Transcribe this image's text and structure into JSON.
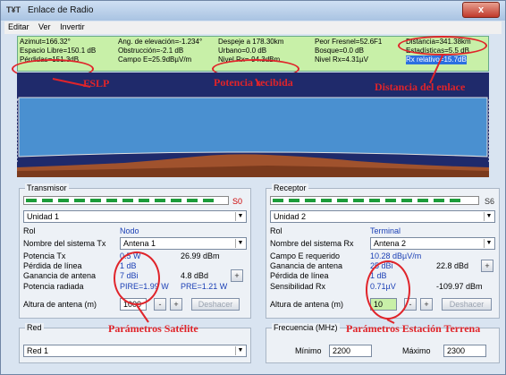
{
  "window": {
    "title": "Enlace de Radio",
    "app_icon": "T¥T",
    "close_label": "x"
  },
  "menu": [
    "Editar",
    "Ver",
    "Invertir"
  ],
  "info": {
    "azimut": "Azimut=166.32°",
    "espacio_libre": "Espacio Libre=150.1 dB",
    "perdidas": "Pérdidas=151.3dB",
    "ang_elev": "Ang. de elevación=-1.234°",
    "obstruccion": "Obstrucción=-2.1 dB",
    "campo_e": "Campo E=25.9dBµV/m",
    "despeje": "Despeje a 178.30km",
    "urbano": "Urbano=0.0 dB",
    "nivel_rx_dbm": "Nivel Rx=-94.3dBm",
    "peor_fresnel": "Peor Fresnel=52.6F1",
    "bosque": "Bosque=0.0 dB",
    "nivel_rx_uv": "Nivel Rx=4.31µV",
    "distancia": "Distancia=341.38km",
    "estadisticas": "Estadísticas=5.5 dB",
    "rx_relativo": "Rx relativo=15.7dB"
  },
  "annotations": {
    "fslp": "FSLP",
    "potencia": "Potencia recibida",
    "distancia": "Distancia del enlace",
    "sat": "Parámetros Satélite",
    "terrena": "Parámetros Estación Terrena"
  },
  "transmisor": {
    "group": "Transmisor",
    "meter_label": "S0",
    "unit": "Unidad  1",
    "rol_label": "Rol",
    "rol_value": "Nodo",
    "sistema_label": "Nombre del sistema Tx",
    "sistema_value": "Antena 1",
    "potencia_label": "Potencia Tx",
    "potencia_w": "0.5 W",
    "potencia_dbm": "26.99 dBm",
    "perdida_label": "Pérdida de línea",
    "perdida_value": "1 dB",
    "ganancia_label": "Ganancia de antena",
    "ganancia_dbi": "7 dBi",
    "ganancia_dbd": "4.8 dBd",
    "radiada_label": "Potencia radiada",
    "pire": "PIRE=1.99 W",
    "pre": "PRE=1.21 W",
    "altura_label": "Altura de antena (m)",
    "altura_value": "1000",
    "deshacer": "Deshacer"
  },
  "receptor": {
    "group": "Receptor",
    "meter_label": "S6",
    "unit": "Unidad  2",
    "rol_label": "Rol",
    "rol_value": "Terminal",
    "sistema_label": "Nombre del sistema Rx",
    "sistema_value": "Antena  2",
    "campo_label": "Campo E requerido",
    "campo_value": "10.28 dBµV/m",
    "ganancia_label": "Ganancia de antena",
    "ganancia_dbi": "25 dBi",
    "ganancia_dbd": "22.8 dBd",
    "perdida_label": "Pérdida de línea",
    "perdida_value": "1 dB",
    "sens_label": "Sensibilidad Rx",
    "sens_uv": "0.71µV",
    "sens_dbm": "-109.97 dBm",
    "altura_label": "Altura de antena (m)",
    "altura_value": "10",
    "deshacer": "Deshacer"
  },
  "red": {
    "group": "Red",
    "value": "Red 1"
  },
  "frecuencia": {
    "group": "Frecuencia (MHz)",
    "min_label": "Mínimo",
    "min_value": "2200",
    "max_label": "Máximo",
    "max_value": "2300"
  },
  "plus": "+",
  "minus": "-",
  "colors": {
    "info_bg": "#c8f0a8",
    "annotation": "#e0242a",
    "profile_bg": "#1f2a6b",
    "terrain": "#a0522d",
    "meter_green": "#1c9c3a"
  }
}
